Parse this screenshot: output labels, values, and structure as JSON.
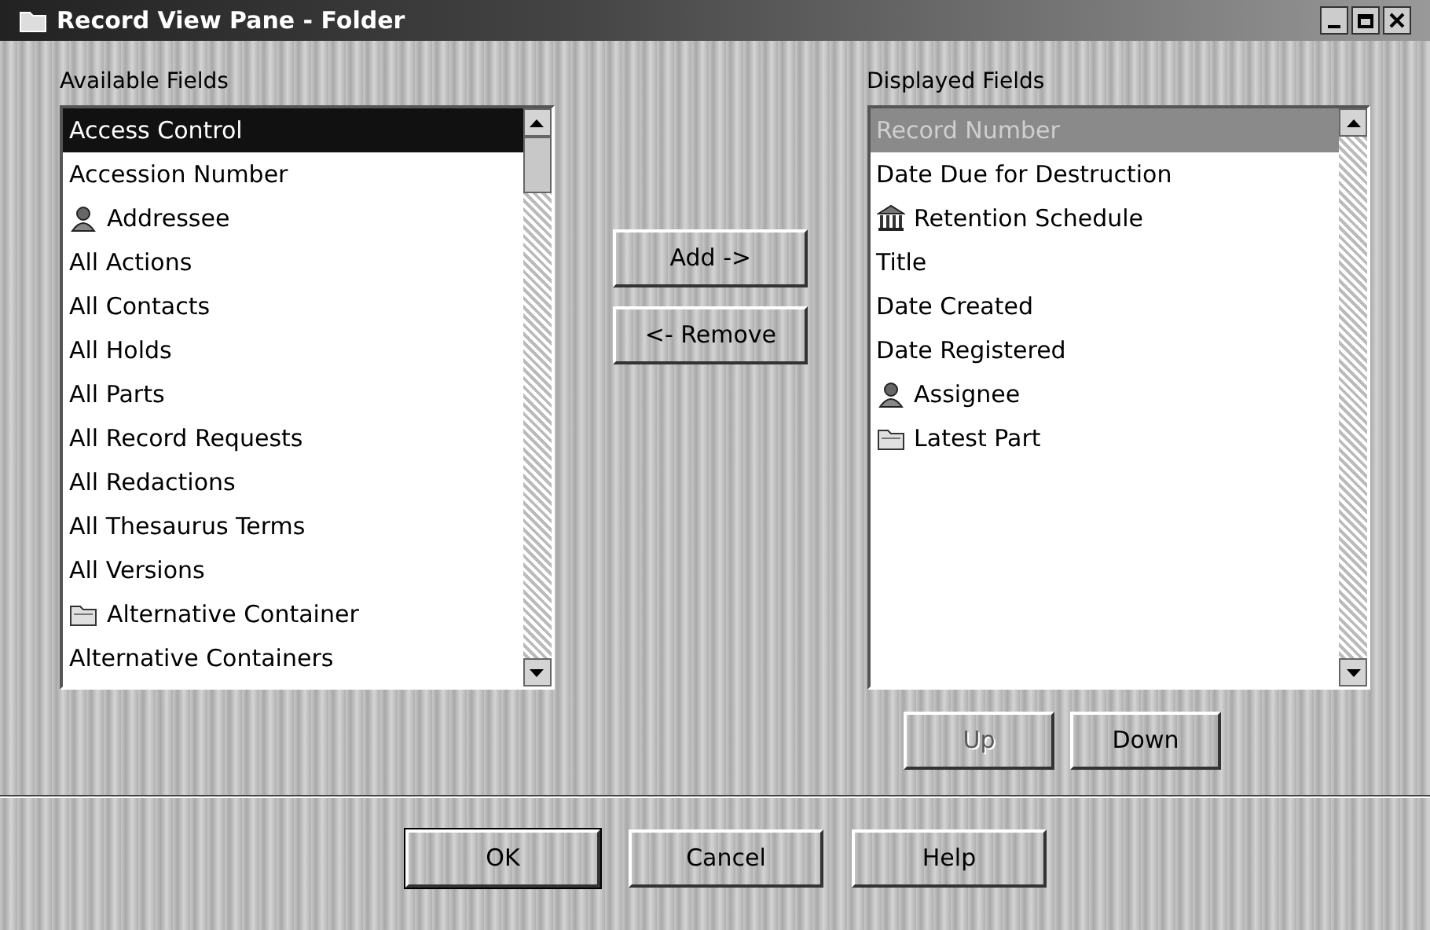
{
  "window": {
    "title": "Record View Pane - Folder"
  },
  "available": {
    "label": "Available Fields",
    "items": [
      {
        "text": "Access Control",
        "kind": "plain",
        "selected": true
      },
      {
        "text": "Accession Number",
        "kind": "plain",
        "selected": false
      },
      {
        "text": "Addressee",
        "kind": "person",
        "selected": false
      },
      {
        "text": "All Actions",
        "kind": "plain",
        "selected": false
      },
      {
        "text": "All Contacts",
        "kind": "plain",
        "selected": false
      },
      {
        "text": "All Holds",
        "kind": "plain",
        "selected": false
      },
      {
        "text": "All Parts",
        "kind": "plain",
        "selected": false
      },
      {
        "text": "All Record Requests",
        "kind": "plain",
        "selected": false
      },
      {
        "text": "All Redactions",
        "kind": "plain",
        "selected": false
      },
      {
        "text": "All Thesaurus Terms",
        "kind": "plain",
        "selected": false
      },
      {
        "text": "All Versions",
        "kind": "plain",
        "selected": false
      },
      {
        "text": "Alternative Container",
        "kind": "folder",
        "selected": false
      },
      {
        "text": "Alternative Containers",
        "kind": "plain",
        "selected": false
      }
    ]
  },
  "move_buttons": [
    {
      "label": "Add ->",
      "disabled": false
    },
    {
      "label": "<- Remove",
      "disabled": false
    }
  ],
  "displayed": {
    "label": "Displayed Fields",
    "items": [
      {
        "text": "Record Number",
        "kind": "plain",
        "selected": true
      },
      {
        "text": "Date Due for Destruction",
        "kind": "plain",
        "selected": false
      },
      {
        "text": "Retention Schedule",
        "kind": "building",
        "selected": false
      },
      {
        "text": "Title",
        "kind": "plain",
        "selected": false
      },
      {
        "text": "Date Created",
        "kind": "plain",
        "selected": false
      },
      {
        "text": "Date Registered",
        "kind": "plain",
        "selected": false
      },
      {
        "text": "Assignee",
        "kind": "person",
        "selected": false
      },
      {
        "text": "Latest Part",
        "kind": "folder",
        "selected": false
      }
    ]
  },
  "order_buttons": [
    {
      "label": "Up",
      "disabled": true
    },
    {
      "label": "Down",
      "disabled": false
    }
  ],
  "dialog_buttons": [
    {
      "label": "OK",
      "default": true
    },
    {
      "label": "Cancel",
      "default": false
    },
    {
      "label": "Help",
      "default": false
    }
  ]
}
